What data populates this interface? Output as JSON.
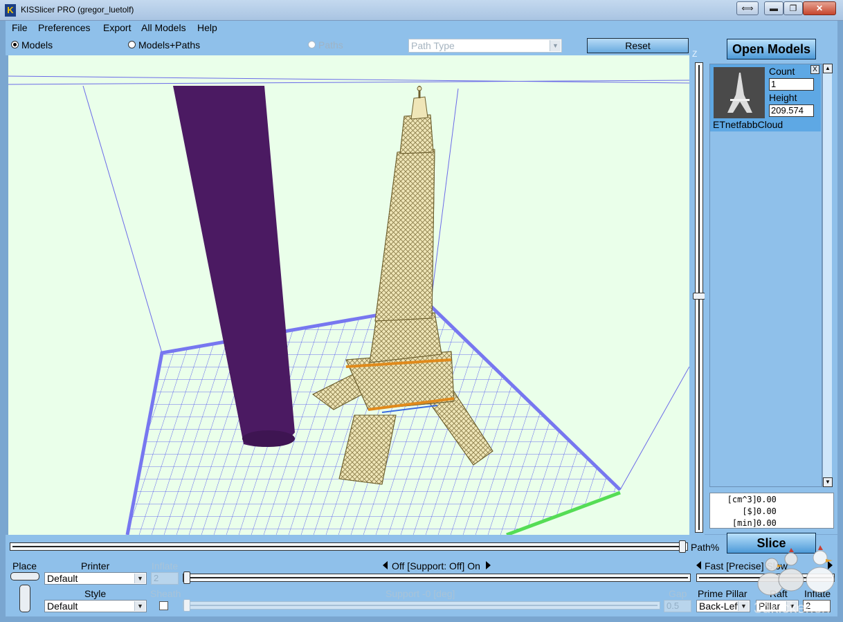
{
  "window": {
    "title": "KISSlicer PRO (gregor_luetolf)",
    "app_icon_glyph": "K",
    "buttons": {
      "swap": "⟺",
      "minimize": "▬",
      "maximize": "❐",
      "close": "✕"
    }
  },
  "menu": [
    "File",
    "Preferences",
    "Export",
    "All Models",
    "Help"
  ],
  "view_modes": {
    "models": {
      "label": "Models",
      "checked": true
    },
    "models_paths": {
      "label": "Models+Paths",
      "checked": false
    },
    "paths": {
      "label": "Paths",
      "enabled": false
    }
  },
  "path_type": {
    "value": "Path Type",
    "enabled": false
  },
  "reset_label": "Reset",
  "z_axis_label": "Z",
  "open_models_label": "Open Models",
  "model": {
    "name": "ETnetfabbCloud",
    "count_label": "Count",
    "count_value": "1",
    "height_label": "Height",
    "height_value": "209.574",
    "remove_label": "X"
  },
  "stats": [
    {
      "unit": "[cm^3]",
      "value": "0.00"
    },
    {
      "unit": "[$]",
      "value": "0.00"
    },
    {
      "unit": "[min]",
      "value": "0.00"
    }
  ],
  "path_pct_label": "Path%",
  "slice_label": "Slice",
  "controls": {
    "place_label": "Place",
    "printer_label": "Printer",
    "printer_value": "Default",
    "style_label": "Style",
    "style_value": "Default",
    "inflate_label": "Inflate",
    "inflate_value": "2",
    "sheath_label": "Sheath",
    "support_toggle_label": "Off [Support: Off] On",
    "support_angle_label": "Support -0 [deg]",
    "gap_label": "Gap",
    "gap_value": "0.5",
    "speed_label": "Fast [Precise] Slow",
    "prime_pillar_label": "Prime Pillar",
    "prime_pillar_value": "Back-Left",
    "raft_label": "Raft",
    "raft_value": "Pillar",
    "inflate2_label": "Inflate",
    "inflate2_value": "2"
  },
  "watermark_text": "3dkicker.ch",
  "colors": {
    "panel_blue": "#8fc0ea",
    "viewport_bg": "#eaffea",
    "support_pillar": "#4b1a62",
    "model_fill": "#efe6b8",
    "bed_edge": "#7777f0",
    "bed_edge_front": "#55dd55"
  }
}
